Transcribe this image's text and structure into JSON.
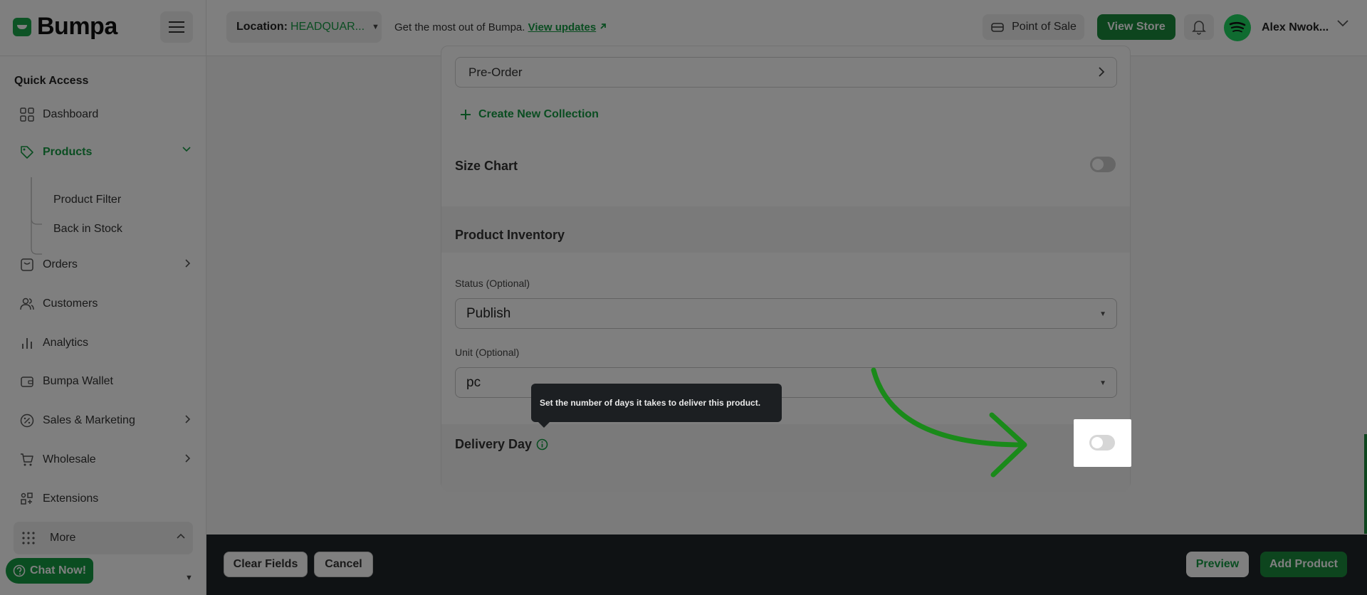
{
  "header": {
    "logo_text": "Bumpa",
    "location_label": "Location:",
    "location_value": "HEADQUAR...",
    "promo_text": "Get the most out of Bumpa.",
    "promo_link": "View updates",
    "pos_label": "Point of Sale",
    "view_store_label": "View Store",
    "user_name": "Alex Nwok..."
  },
  "sidebar": {
    "section_title": "Quick Access",
    "items": {
      "dashboard": "Dashboard",
      "products": "Products",
      "product_filter": "Product Filter",
      "back_in_stock": "Back in Stock",
      "orders": "Orders",
      "customers": "Customers",
      "analytics": "Analytics",
      "wallet": "Bumpa Wallet",
      "sales_marketing": "Sales & Marketing",
      "wholesale": "Wholesale",
      "extensions": "Extensions",
      "more": "More"
    },
    "chat_label": "Chat Now!"
  },
  "form": {
    "collection_value": "Pre-Order",
    "create_collection": "Create New Collection",
    "size_chart_label": "Size Chart",
    "inventory_title": "Product Inventory",
    "status_label": "Status (Optional)",
    "status_value": "Publish",
    "unit_label": "Unit (Optional)",
    "unit_value": "pc",
    "delivery_label": "Delivery Day",
    "tooltip_text": "Set the number of days it takes to deliver this product."
  },
  "footer": {
    "clear_label": "Clear Fields",
    "cancel_label": "Cancel",
    "preview_label": "Preview",
    "add_label": "Add Product"
  },
  "colors": {
    "brand_green": "#149a43",
    "button_green": "#1a8a3c",
    "footer_dark": "#1f2428"
  }
}
